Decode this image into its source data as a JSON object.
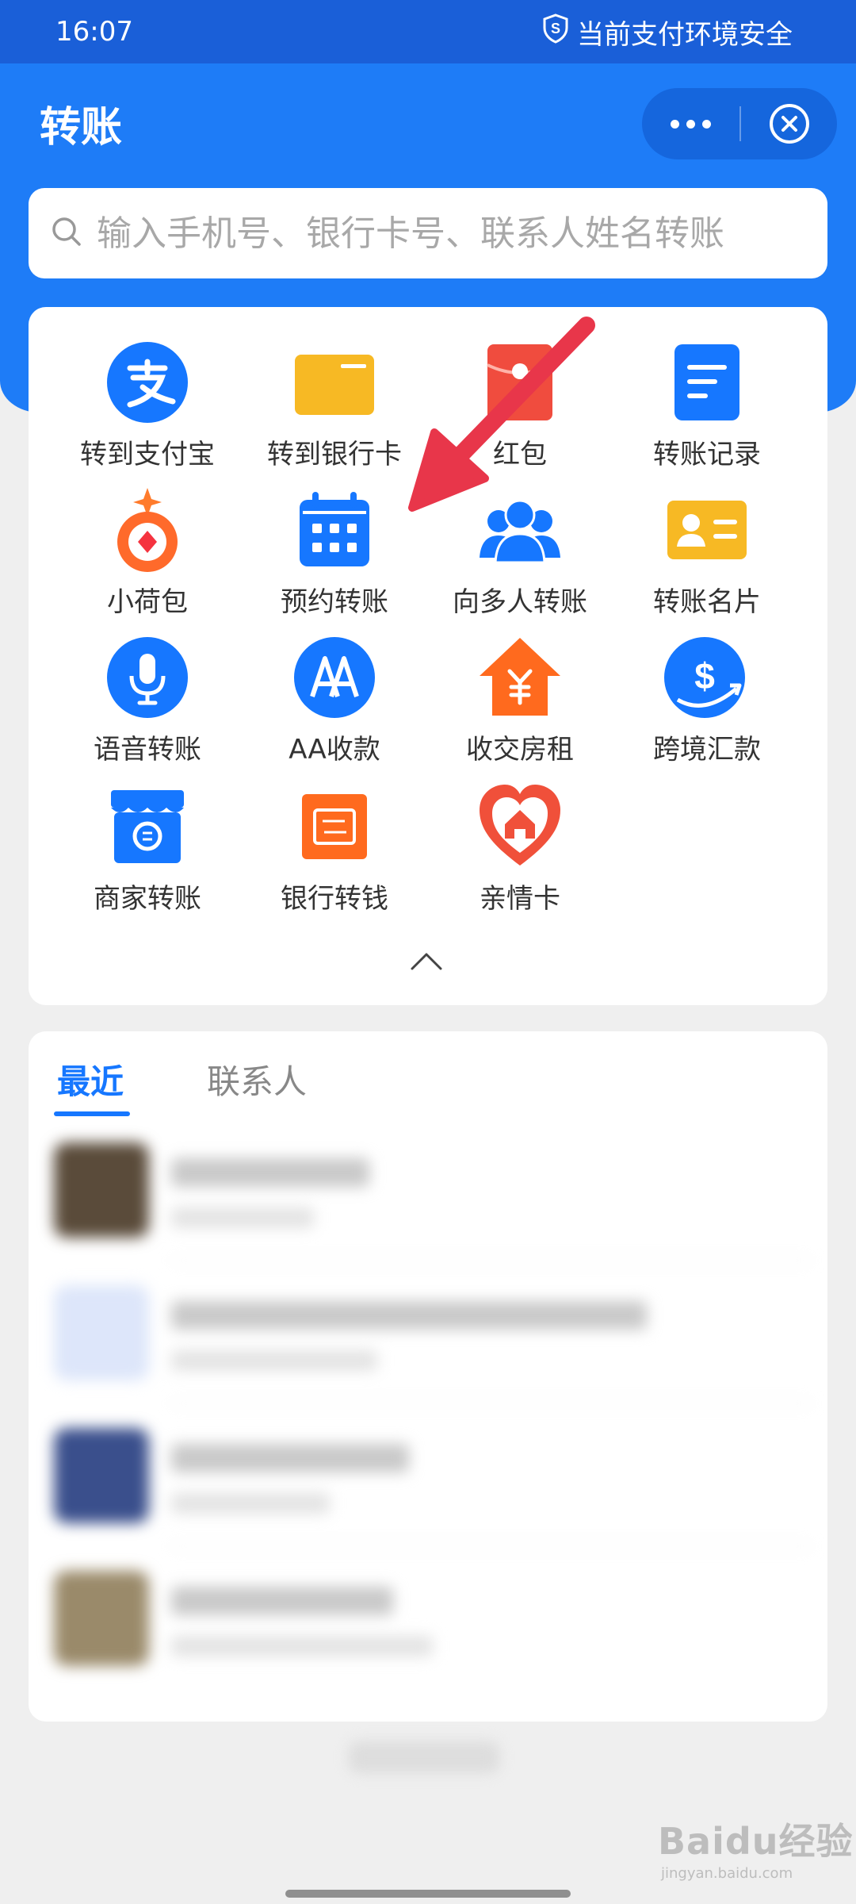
{
  "status_bar": {
    "time": "16:07",
    "security_text": "当前支付环境安全",
    "security_icon": "shield-s-icon"
  },
  "header": {
    "title": "转账",
    "more_icon": "more-dots-icon",
    "close_icon": "close-circle-icon"
  },
  "search": {
    "placeholder": "输入手机号、银行卡号、联系人姓名转账",
    "icon": "search-icon"
  },
  "grid": {
    "items": [
      {
        "label": "转到支付宝",
        "icon": "alipay-icon"
      },
      {
        "label": "转到银行卡",
        "icon": "bank-card-icon"
      },
      {
        "label": "红包",
        "icon": "red-envelope-icon"
      },
      {
        "label": "转账记录",
        "icon": "record-document-icon"
      },
      {
        "label": "小荷包",
        "icon": "lotus-pouch-icon"
      },
      {
        "label": "预约转账",
        "icon": "calendar-icon"
      },
      {
        "label": "向多人转账",
        "icon": "multi-person-icon"
      },
      {
        "label": "转账名片",
        "icon": "business-card-icon"
      },
      {
        "label": "语音转账",
        "icon": "microphone-icon"
      },
      {
        "label": "AA收款",
        "icon": "aa-icon"
      },
      {
        "label": "收交房租",
        "icon": "house-yuan-icon"
      },
      {
        "label": "跨境汇款",
        "icon": "dollar-globe-icon"
      },
      {
        "label": "商家转账",
        "icon": "shop-icon"
      },
      {
        "label": "银行转钱",
        "icon": "bank-transfer-icon"
      },
      {
        "label": "亲情卡",
        "icon": "heart-home-icon"
      }
    ],
    "collapse_icon": "chevron-up-icon"
  },
  "recent": {
    "tabs": [
      "最近",
      "联系人"
    ],
    "active_tab": "最近"
  },
  "watermark": {
    "brand": "Baidu经验",
    "url": "jingyan.baidu.com"
  },
  "colors": {
    "header_blue": "#1e7cf7",
    "status_blue": "#1a5fd8",
    "accent_blue": "#1677ff",
    "arrow_red": "#e8364a"
  }
}
